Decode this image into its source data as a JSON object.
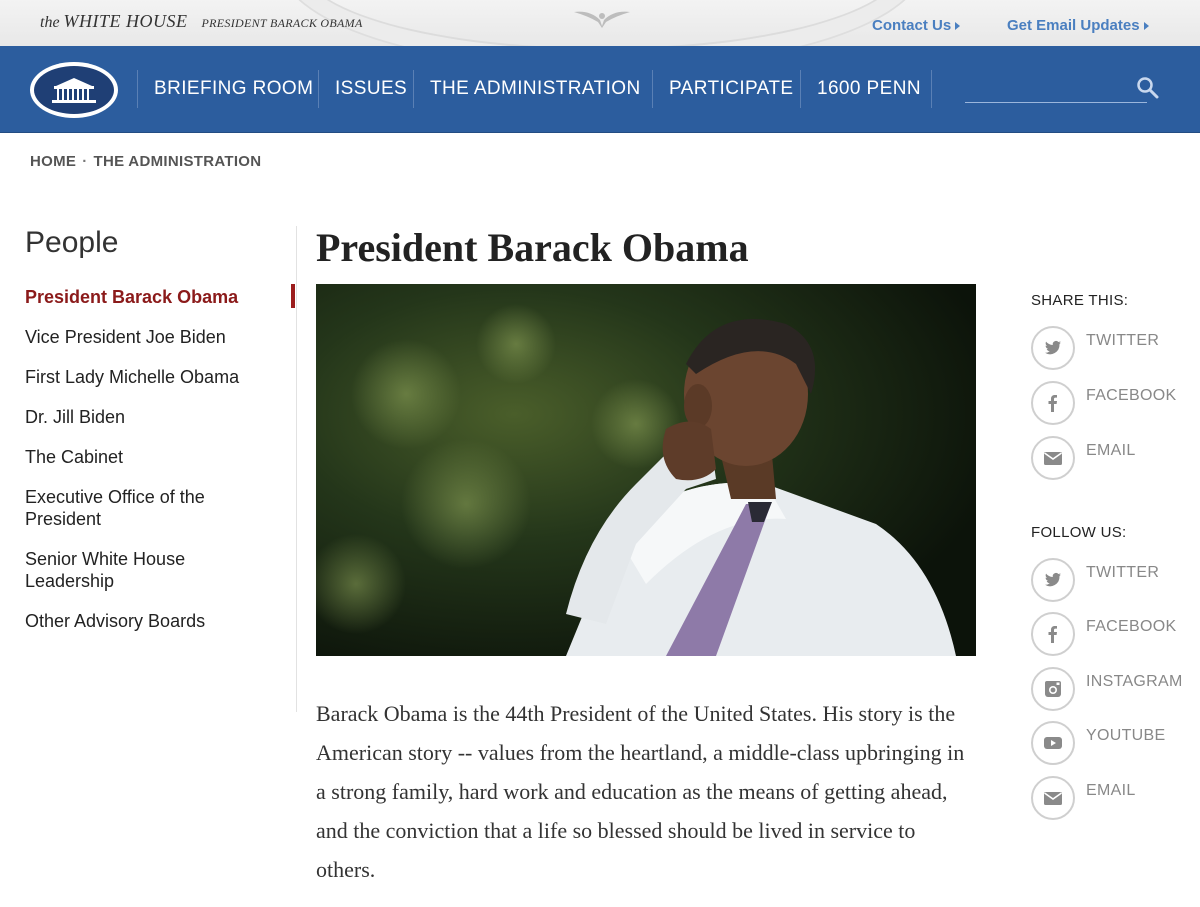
{
  "header": {
    "site_the": "the",
    "site_name": "WHITE HOUSE",
    "site_subtitle": "PRESIDENT BARACK OBAMA",
    "contact": "Contact Us",
    "email_updates": "Get Email Updates"
  },
  "nav": {
    "items": [
      "BRIEFING ROOM",
      "ISSUES",
      "THE ADMINISTRATION",
      "PARTICIPATE",
      "1600 PENN"
    ],
    "search_placeholder": ""
  },
  "breadcrumb": {
    "home": "HOME",
    "separator": "·",
    "current": "THE ADMINISTRATION"
  },
  "sidebar": {
    "title": "People",
    "items": [
      "President Barack Obama",
      "Vice President Joe Biden",
      "First Lady Michelle Obama",
      "Dr. Jill Biden",
      "The Cabinet",
      "Executive Office of the President",
      "Senior White House Leadership",
      "Other Advisory Boards"
    ],
    "active_index": 0
  },
  "main": {
    "title": "President Barack Obama",
    "body": "Barack Obama is the 44th President of the United States. His story is the American story -- values from the heartland, a middle-class upbringing in a strong family, hard work and education as the means of getting ahead, and the conviction that a life so blessed should be lived in service to others."
  },
  "share": {
    "title": "SHARE THIS:",
    "items": [
      {
        "label": "TWITTER",
        "icon": "twitter-icon"
      },
      {
        "label": "FACEBOOK",
        "icon": "facebook-icon"
      },
      {
        "label": "EMAIL",
        "icon": "email-icon"
      }
    ]
  },
  "follow": {
    "title": "FOLLOW US:",
    "items": [
      {
        "label": "TWITTER",
        "icon": "twitter-icon"
      },
      {
        "label": "FACEBOOK",
        "icon": "facebook-icon"
      },
      {
        "label": "INSTAGRAM",
        "icon": "instagram-icon"
      },
      {
        "label": "YOUTUBE",
        "icon": "youtube-icon"
      },
      {
        "label": "EMAIL",
        "icon": "email-icon"
      }
    ]
  },
  "colors": {
    "nav_blue": "#2c5d9e",
    "link_blue": "#4a7fc0",
    "active_red": "#8b1a1a",
    "icon_gray": "#888888"
  }
}
